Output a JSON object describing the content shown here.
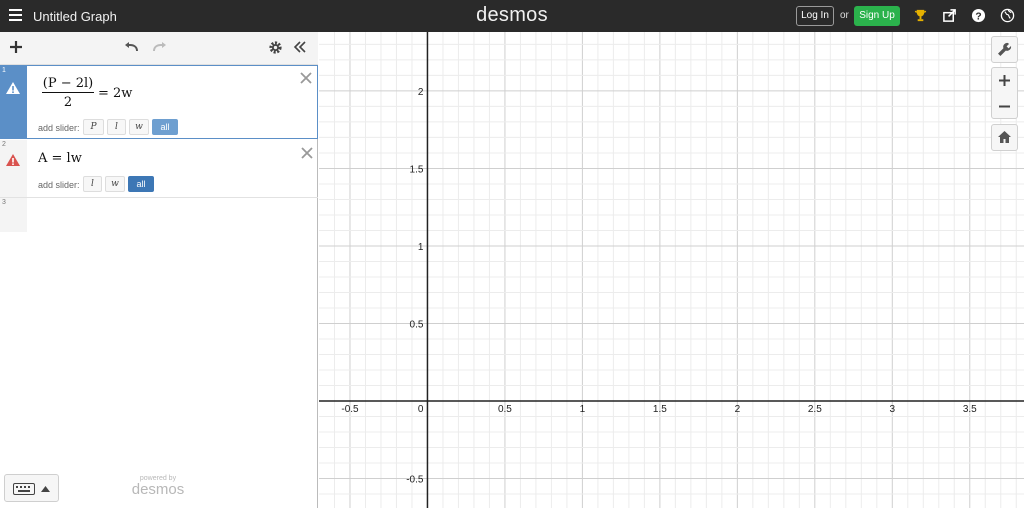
{
  "topbar": {
    "menu_icon": "hamburger-icon",
    "title": "Untitled Graph",
    "logo": "desmos",
    "login_label": "Log In",
    "or_label": "or",
    "signup_label": "Sign Up",
    "icons": [
      "trophy-icon",
      "share-icon",
      "help-icon",
      "globe-icon"
    ]
  },
  "panel": {
    "toolbar_icons": [
      "add-icon",
      "undo-icon",
      "redo-icon",
      "settings-icon",
      "collapse-icon"
    ],
    "expressions": [
      {
        "index": "1",
        "numerator": "(P − 2l)",
        "denominator": "2",
        "rhs": "= 2w",
        "add_slider_label": "add slider:",
        "sliders": [
          "P",
          "l",
          "w",
          "all"
        ],
        "selected": true,
        "icon": "warning-icon"
      },
      {
        "index": "2",
        "latex": "A = lw",
        "add_slider_label": "add slider:",
        "sliders": [
          "l",
          "w",
          "all"
        ],
        "selected": false,
        "icon": "warning-icon"
      },
      {
        "index": "3"
      }
    ],
    "powered_by": "powered by",
    "powered_logo": "desmos"
  },
  "graph": {
    "x_ticks": [
      "-0.5",
      "0",
      "0.5",
      "1",
      "1.5",
      "2",
      "2.5",
      "3",
      "3.5"
    ],
    "y_ticks": [
      "2",
      "1.5",
      "1",
      "0.5",
      "-0.5"
    ],
    "x_range": [
      -0.7,
      3.85
    ],
    "y_range": [
      -0.69,
      2.38
    ],
    "grid": true,
    "buttons": [
      "wrench-icon",
      "zoom-in-icon",
      "zoom-out-icon",
      "home-icon"
    ],
    "colors": {
      "axis": "#222222",
      "major_grid": "#cfcfcf",
      "minor_grid": "#ececec"
    }
  }
}
